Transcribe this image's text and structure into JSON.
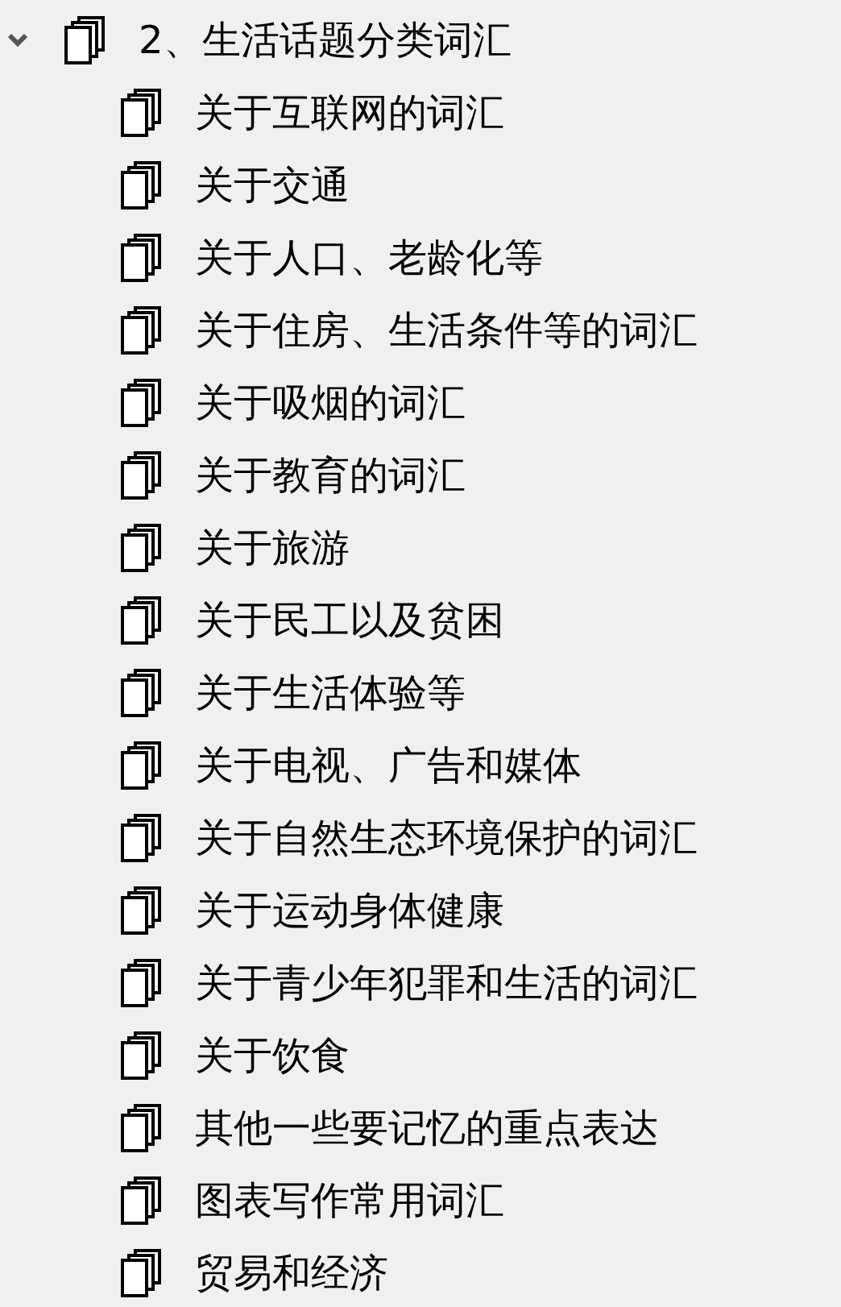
{
  "tree": [
    {
      "label": "2、生活话题分类词汇",
      "expanded": true,
      "children": [
        {
          "label": "关于互联网的词汇"
        },
        {
          "label": "关于交通"
        },
        {
          "label": "关于人口、老龄化等"
        },
        {
          "label": "关于住房、生活条件等的词汇"
        },
        {
          "label": "关于吸烟的词汇"
        },
        {
          "label": "关于教育的词汇"
        },
        {
          "label": "关于旅游"
        },
        {
          "label": "关于民工以及贫困"
        },
        {
          "label": "关于生活体验等"
        },
        {
          "label": "关于电视、广告和媒体"
        },
        {
          "label": "关于自然生态环境保护的词汇"
        },
        {
          "label": "关于运动身体健康"
        },
        {
          "label": "关于青少年犯罪和生活的词汇"
        },
        {
          "label": "关于饮食"
        },
        {
          "label": "其他一些要记忆的重点表达"
        },
        {
          "label": "图表写作常用词汇"
        },
        {
          "label": "贸易和经济"
        }
      ]
    }
  ]
}
